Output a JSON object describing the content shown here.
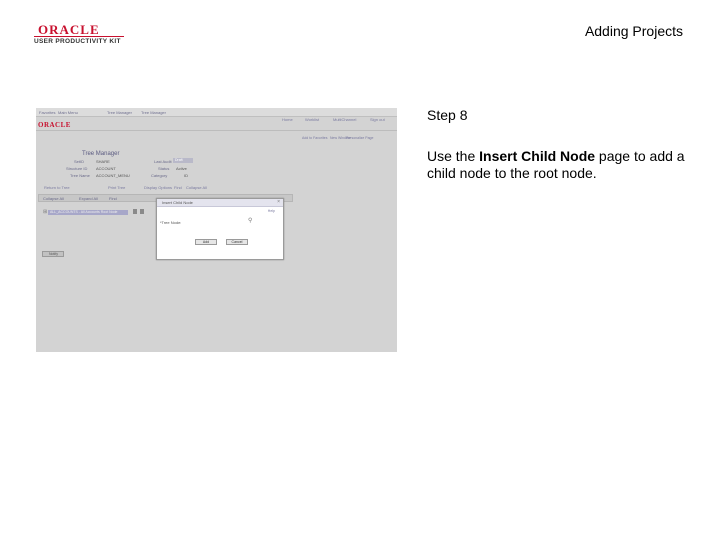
{
  "header": {
    "logo_oracle": "ORACLE",
    "logo_product": "USER PRODUCTIVITY KIT",
    "title": "Adding Projects"
  },
  "step": {
    "label": "Step 8",
    "desc_before": "Use the ",
    "desc_bold": "Insert Child Node",
    "desc_after": " page to add a child node to the root node."
  },
  "screenshot": {
    "nav": [
      "Favorites",
      "Main Menu",
      "Tree Manager",
      "Tree Manager"
    ],
    "brand": "ORACLE",
    "top_links": [
      "Home",
      "Worklist",
      "MultiChannel",
      "Sign out"
    ],
    "util_links": [
      "Add to Favorites",
      "New Window",
      "Personalize Page"
    ],
    "page_title": "Tree Manager",
    "fields": {
      "setid_label": "SetID",
      "setid_value": "SHARE",
      "structure_label": "Structure ID",
      "structure_value": "ACCOUNT",
      "treename_label": "Tree Name",
      "treename_value": "ACCOUNT_MENU",
      "lastaudit_label": "Last Audit",
      "lastaudit_value": "Draft",
      "status_label": "Status",
      "status_value": "Active",
      "category_label": "Category",
      "category_value": "ID"
    },
    "row_links": [
      "Return to Tree",
      "Print Tree",
      "Display Options",
      "Find",
      "Collapse All"
    ],
    "grid_headers": [
      "Collapse All",
      "Expand All",
      "Find"
    ],
    "root_node": "ALL_ACCOUNTS - All Accounts Root Node",
    "notify": "Notify",
    "modal": {
      "title": "Insert Child Node",
      "close": "×",
      "help": "Help",
      "field_label": "*Tree Node:",
      "add": "Add",
      "cancel": "Cancel"
    }
  }
}
